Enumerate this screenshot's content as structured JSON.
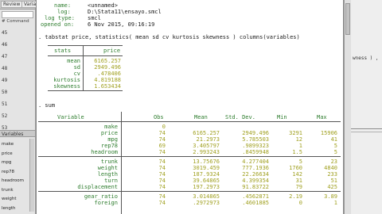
{
  "left_pane": {
    "tabs": [
      "Review",
      "Varia"
    ],
    "review_header": "# Command",
    "history_numbers": [
      "45",
      "46",
      "47",
      "48",
      "49",
      "50",
      "51",
      "52",
      "53"
    ],
    "variables_title": "Variables",
    "variables": [
      "make",
      "price",
      "mpg",
      "rep78",
      "headroom",
      "trunk",
      "weight",
      "length"
    ]
  },
  "log_header": {
    "name_label": "name:",
    "name_value": "<unnamed>",
    "log_label": "log:",
    "log_value": "D:\\Stata11\\ensayo.smcl",
    "type_label": "log type:",
    "type_value": "smcl",
    "opened_label": "opened on:",
    "opened_value": "6 Nov 2015, 09:16:19"
  },
  "commands": {
    "tabstat": ". tabstat price, statistics( mean sd cv kurtosis skewness ) columns(variables)",
    "sum": ". sum"
  },
  "tabstat": {
    "header_stub": "stats",
    "header_var": "price",
    "rows": [
      {
        "stat": "mean",
        "value": "6165.257"
      },
      {
        "stat": "sd",
        "value": "2949.496"
      },
      {
        "stat": "cv",
        "value": ".478406"
      },
      {
        "stat": "kurtosis",
        "value": "4.819188"
      },
      {
        "stat": "skewness",
        "value": "1.653434"
      }
    ]
  },
  "summary": {
    "headers": {
      "variable": "Variable",
      "obs": "Obs",
      "mean": "Mean",
      "sd": "Std. Dev.",
      "min": "Min",
      "max": "Max"
    },
    "groups": [
      [
        {
          "var": "make",
          "obs": "0",
          "mean": "",
          "sd": "",
          "min": "",
          "max": ""
        },
        {
          "var": "price",
          "obs": "74",
          "mean": "6165.257",
          "sd": "2949.496",
          "min": "3291",
          "max": "15906"
        },
        {
          "var": "mpg",
          "obs": "74",
          "mean": "21.2973",
          "sd": "5.785503",
          "min": "12",
          "max": "41"
        },
        {
          "var": "rep78",
          "obs": "69",
          "mean": "3.405797",
          "sd": ".9899323",
          "min": "1",
          "max": "5"
        },
        {
          "var": "headroom",
          "obs": "74",
          "mean": "2.993243",
          "sd": ".8459948",
          "min": "1.5",
          "max": "5"
        }
      ],
      [
        {
          "var": "trunk",
          "obs": "74",
          "mean": "13.75676",
          "sd": "4.277404",
          "min": "5",
          "max": "23"
        },
        {
          "var": "weight",
          "obs": "74",
          "mean": "3019.459",
          "sd": "777.1936",
          "min": "1760",
          "max": "4840"
        },
        {
          "var": "length",
          "obs": "74",
          "mean": "187.9324",
          "sd": "22.26634",
          "min": "142",
          "max": "233"
        },
        {
          "var": "turn",
          "obs": "74",
          "mean": "39.64865",
          "sd": "4.399354",
          "min": "31",
          "max": "51"
        },
        {
          "var": "displacement",
          "obs": "74",
          "mean": "197.2973",
          "sd": "91.83722",
          "min": "79",
          "max": "425"
        }
      ],
      [
        {
          "var": "gear_ratio",
          "obs": "74",
          "mean": "3.014865",
          "sd": ".4562871",
          "min": "2.19",
          "max": "3.89"
        },
        {
          "var": "foreign",
          "obs": "74",
          "mean": ".2972973",
          "sd": ".4601885",
          "min": "0",
          "max": "1"
        }
      ]
    ]
  },
  "right_pane": {
    "fragment": "wness ) ,"
  }
}
